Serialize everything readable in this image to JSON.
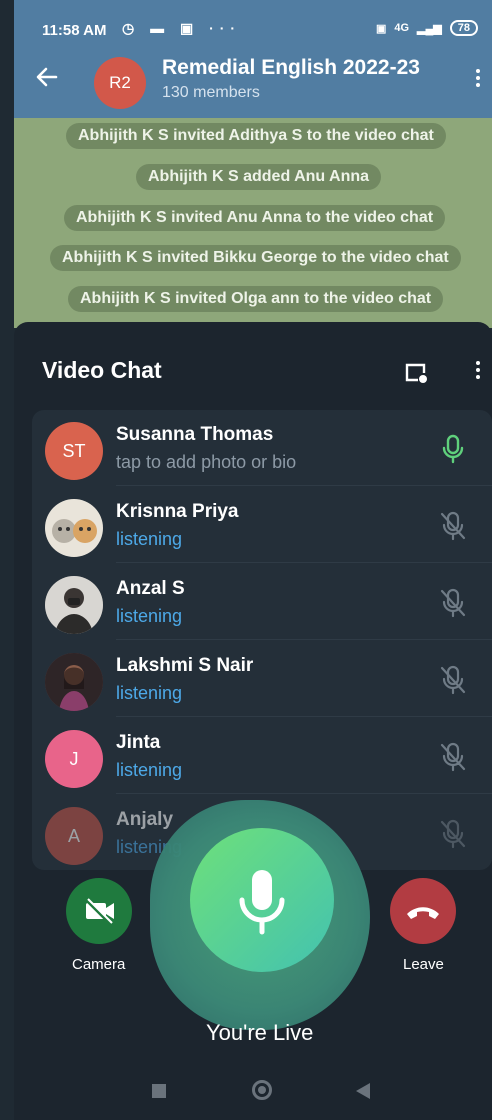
{
  "status_bar": {
    "time": "11:58 AM",
    "network": "4G",
    "battery": "78"
  },
  "header": {
    "avatar_initials": "R2",
    "title": "Remedial English 2022-23",
    "subtitle": "130 members",
    "back_icon": "arrow-left-icon",
    "menu_icon": "more-vertical-icon"
  },
  "chat": {
    "messages": [
      "Abhijith K S invited Adithya S to the video chat",
      "Abhijith K S added Anu Anna",
      "Abhijith K S invited Anu Anna to the video chat",
      "Abhijith K S invited Bikku George to the video chat",
      "Abhijith K S invited Olga ann to the video chat"
    ]
  },
  "video_chat": {
    "title": "Video Chat",
    "participants": [
      {
        "name": "Susanna Thomas",
        "status": "tap to add photo or bio",
        "initials": "ST",
        "avatar_color": "#d9634e",
        "status_color": "#8d9aa6",
        "mic": "active"
      },
      {
        "name": "Krisnna Priya",
        "status": "listening",
        "initials": "",
        "avatar_color": "#c9c2b4",
        "status_color": "#4da9e8",
        "mic": "muted"
      },
      {
        "name": "Anzal S",
        "status": "listening",
        "initials": "",
        "avatar_color": "#5c5a57",
        "status_color": "#4da9e8",
        "mic": "muted"
      },
      {
        "name": "Lakshmi S Nair",
        "status": "listening",
        "initials": "",
        "avatar_color": "#6b4a4e",
        "status_color": "#4da9e8",
        "mic": "muted"
      },
      {
        "name": "Jinta",
        "status": "listening",
        "initials": "J",
        "avatar_color": "#e8648a",
        "status_color": "#4da9e8",
        "mic": "muted"
      },
      {
        "name": "Anjaly",
        "status": "listening",
        "initials": "A",
        "avatar_color": "#c5544a",
        "status_color": "#4da9e8",
        "mic": "muted"
      }
    ]
  },
  "controls": {
    "camera_label": "Camera",
    "leave_label": "Leave",
    "live_label": "You're Live"
  },
  "colors": {
    "header": "#517da2",
    "sheet": "#1c252e",
    "mic_active": "#5fd07c",
    "mic_muted": "#6f7b86",
    "listening": "#4da9e8"
  }
}
